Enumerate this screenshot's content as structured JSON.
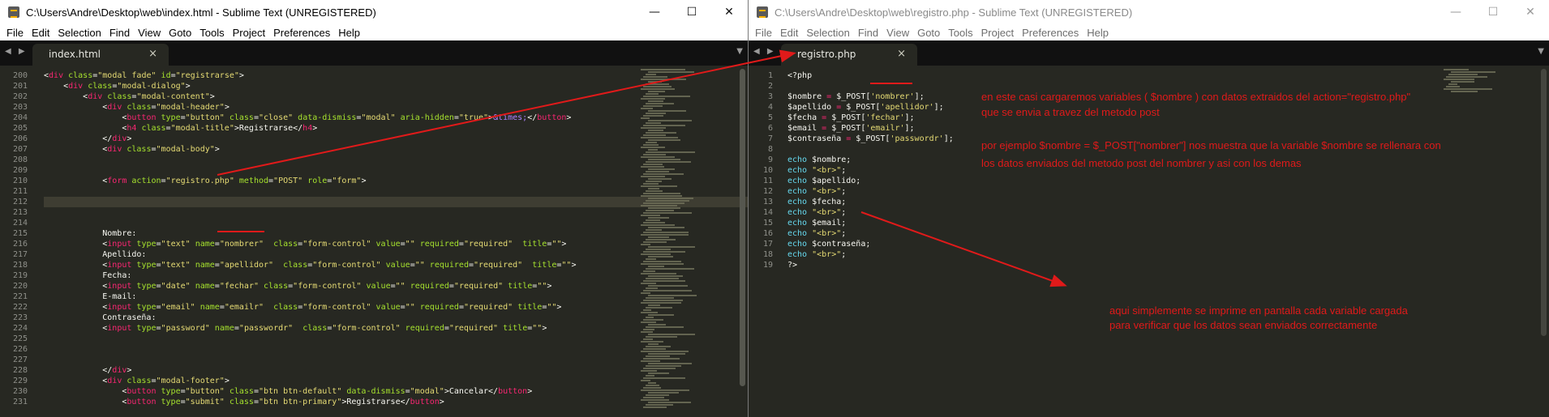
{
  "left_window": {
    "title": "C:\\Users\\Andre\\Desktop\\web\\index.html - Sublime Text (UNREGISTERED)",
    "controls": [
      "—",
      "☐",
      "✕"
    ],
    "menu": [
      "File",
      "Edit",
      "Selection",
      "Find",
      "View",
      "Goto",
      "Tools",
      "Project",
      "Preferences",
      "Help"
    ],
    "tab": {
      "label": "index.html",
      "close": "×"
    },
    "nav": "◀ ▶",
    "dropdown": "▼",
    "lines": [
      {
        "n": "200",
        "t": "<div class=\"modal fade\" id=\"registrarse\">"
      },
      {
        "n": "201",
        "t": "    <div class=\"modal-dialog\">"
      },
      {
        "n": "202",
        "t": "        <div class=\"modal-content\">"
      },
      {
        "n": "203",
        "t": "            <div class=\"modal-header\">"
      },
      {
        "n": "204",
        "t": "                <button type=\"button\" class=\"close\" data-dismiss=\"modal\" aria-hidden=\"true\">&times;</button>"
      },
      {
        "n": "205",
        "t": "                <h4 class=\"modal-title\">Registrarse</h4>"
      },
      {
        "n": "206",
        "t": "            </div>"
      },
      {
        "n": "207",
        "t": "            <div class=\"modal-body\">"
      },
      {
        "n": "208",
        "t": ""
      },
      {
        "n": "209",
        "t": ""
      },
      {
        "n": "210",
        "t": "            <form action=\"registro.php\" method=\"POST\" role=\"form\">"
      },
      {
        "n": "211",
        "t": ""
      },
      {
        "n": "212",
        "t": ""
      },
      {
        "n": "213",
        "t": ""
      },
      {
        "n": "214",
        "t": ""
      },
      {
        "n": "215",
        "t": "            Nombre:"
      },
      {
        "n": "216",
        "t": "            <input type=\"text\" name=\"nombrer\"  class=\"form-control\" value=\"\" required=\"required\"  title=\"\">"
      },
      {
        "n": "217",
        "t": "            Apellido:"
      },
      {
        "n": "218",
        "t": "            <input type=\"text\" name=\"apellidor\"  class=\"form-control\" value=\"\" required=\"required\"  title=\"\">"
      },
      {
        "n": "219",
        "t": "            Fecha:"
      },
      {
        "n": "220",
        "t": "            <input type=\"date\" name=\"fechar\" class=\"form-control\" value=\"\" required=\"required\" title=\"\">"
      },
      {
        "n": "221",
        "t": "            E-mail:"
      },
      {
        "n": "222",
        "t": "            <input type=\"email\" name=\"emailr\"  class=\"form-control\" value=\"\" required=\"required\" title=\"\">"
      },
      {
        "n": "223",
        "t": "            Contraseña:"
      },
      {
        "n": "224",
        "t": "            <input type=\"password\" name=\"passwordr\"  class=\"form-control\" required=\"required\" title=\"\">"
      },
      {
        "n": "225",
        "t": ""
      },
      {
        "n": "226",
        "t": ""
      },
      {
        "n": "227",
        "t": ""
      },
      {
        "n": "228",
        "t": "            </div>"
      },
      {
        "n": "229",
        "t": "            <div class=\"modal-footer\">"
      },
      {
        "n": "230",
        "t": "                <button type=\"button\" class=\"btn btn-default\" data-dismiss=\"modal\">Cancelar</button>"
      },
      {
        "n": "231",
        "t": "                <button type=\"submit\" class=\"btn btn-primary\">Registrarse</button>"
      }
    ],
    "current_line": "212"
  },
  "right_window": {
    "title": "C:\\Users\\Andre\\Desktop\\web\\registro.php - Sublime Text (UNREGISTERED)",
    "controls": [
      "—",
      "☐",
      "✕"
    ],
    "menu": [
      "File",
      "Edit",
      "Selection",
      "Find",
      "View",
      "Goto",
      "Tools",
      "Project",
      "Preferences",
      "Help"
    ],
    "tab": {
      "label": "registro.php",
      "close": "×"
    },
    "nav": "◀ ▶",
    "dropdown": "▼",
    "lines": [
      {
        "n": "1",
        "t": "<?php"
      },
      {
        "n": "2",
        "t": ""
      },
      {
        "n": "3",
        "t": "$nombre = $_POST['nombrer'];"
      },
      {
        "n": "4",
        "t": "$apellido = $_POST['apellidor'];"
      },
      {
        "n": "5",
        "t": "$fecha = $_POST['fechar'];"
      },
      {
        "n": "6",
        "t": "$email = $_POST['emailr'];"
      },
      {
        "n": "7",
        "t": "$contraseña = $_POST['passwordr'];"
      },
      {
        "n": "8",
        "t": ""
      },
      {
        "n": "9",
        "t": "echo $nombre;"
      },
      {
        "n": "10",
        "t": "echo \"<br>\";"
      },
      {
        "n": "11",
        "t": "echo $apellido;"
      },
      {
        "n": "12",
        "t": "echo \"<br>\";"
      },
      {
        "n": "13",
        "t": "echo $fecha;"
      },
      {
        "n": "14",
        "t": "echo \"<br>\";"
      },
      {
        "n": "15",
        "t": "echo $email;"
      },
      {
        "n": "16",
        "t": "echo \"<br>\";"
      },
      {
        "n": "17",
        "t": "echo $contraseña;"
      },
      {
        "n": "18",
        "t": "echo \"<br>\";"
      },
      {
        "n": "19",
        "t": "?>"
      }
    ]
  },
  "annotations": {
    "note1": [
      "en este casi cargaremos variables ( $nombre ) con datos extraidos del action=\"registro.php\"",
      "que se envia a travez del metodo post"
    ],
    "note2": [
      "por ejemplo $nombre = $_POST[\"nombrer\"] nos muestra que la variable $nombre se rellenara con",
      "los datos enviados del metodo post del nombrer y asi con los demas"
    ],
    "note3": [
      "aqui simplemente se imprime en pantalla cada variable cargada",
      "para verificar que los datos sean enviados correctamente"
    ],
    "color": "#e01a1a"
  },
  "colors": {
    "editor_bg": "#272822",
    "tabbar_bg": "#111111",
    "tag": "#f92672",
    "attr": "#a6e22e",
    "string": "#e6db74",
    "keyword": "#66d9ef"
  }
}
